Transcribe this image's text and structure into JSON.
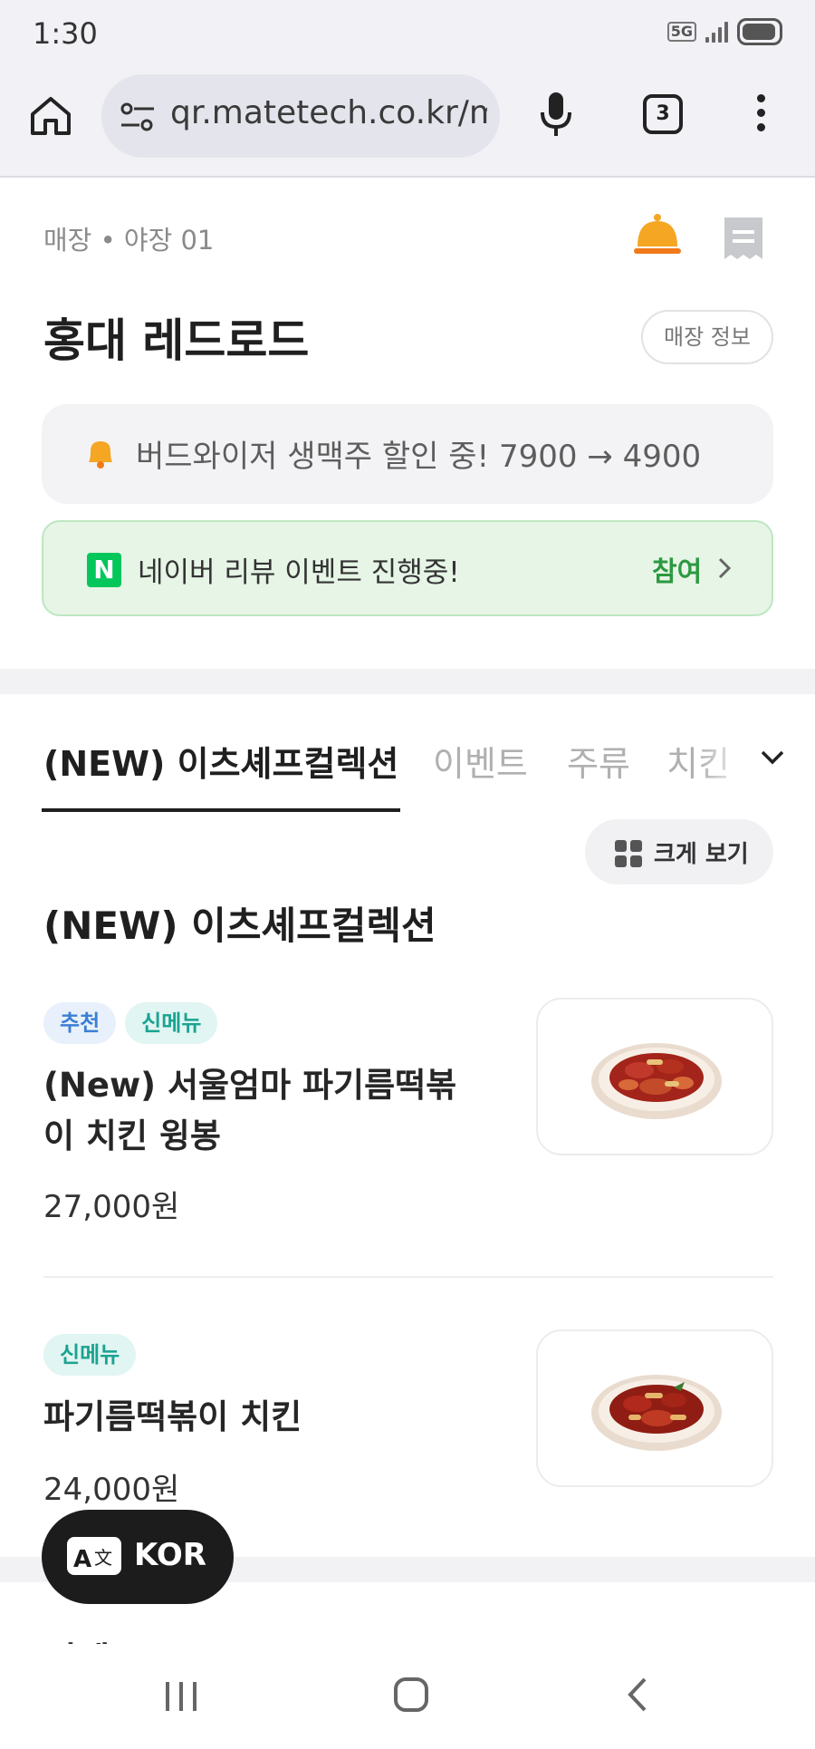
{
  "status_bar": {
    "time": "1:30",
    "network": "5G"
  },
  "browser": {
    "url": "qr.matetech.co.kr/me",
    "tab_count": "3"
  },
  "store": {
    "table_label": "매장 • 야장 01",
    "name": "홍대 레드로드",
    "info_button": "매장 정보"
  },
  "notice": {
    "text": "버드와이저 생맥주 할인 중! 7900 → 4900"
  },
  "naver_banner": {
    "logo_letter": "N",
    "text": "네이버 리뷰 이벤트 진행중!",
    "action": "참여"
  },
  "tabs": [
    {
      "label": "(NEW) 이츠셰프컬렉션",
      "active": true
    },
    {
      "label": "이벤트"
    },
    {
      "label": "주류"
    },
    {
      "label": "치킨"
    }
  ],
  "view_toggle": {
    "label": "크게 보기"
  },
  "section": {
    "title": "(NEW) 이츠셰프컬렉션"
  },
  "menu_items": [
    {
      "badges": [
        "추천",
        "신메뉴"
      ],
      "name": "(New) 서울엄마 파기름떡볶이 치킨 윙봉",
      "price": "27,000원"
    },
    {
      "badges": [
        "신메뉴"
      ],
      "name": "파기름떡볶이 치킨",
      "price": "24,000원"
    }
  ],
  "next_section": {
    "title": "이벤트"
  },
  "language_button": {
    "label": "KOR"
  },
  "colors": {
    "bell": "#f5a623",
    "naver_green": "#03c75a",
    "join_green": "#2c9940"
  }
}
